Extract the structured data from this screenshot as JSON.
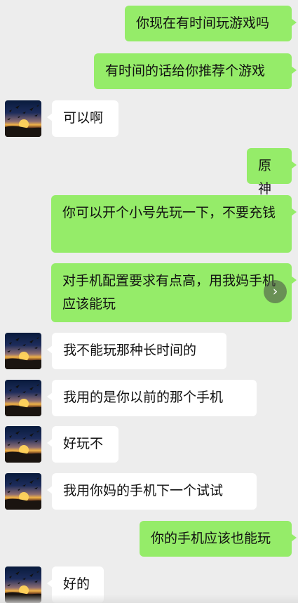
{
  "chat": {
    "messages": [
      {
        "side": "out",
        "text": "你现在有时间玩游戏吗"
      },
      {
        "side": "out",
        "text": "有时间的话给你推荐个游戏"
      },
      {
        "side": "in",
        "text": "可以啊"
      },
      {
        "side": "out",
        "text": "原神"
      },
      {
        "side": "out",
        "text": "你可以开个小号先玩一下，不要充钱"
      },
      {
        "side": "out",
        "text": "对手机配置要求有点高，用我妈手机应该能玩"
      },
      {
        "side": "in",
        "text": "我不能玩那种长时间的"
      },
      {
        "side": "in",
        "text": "我用的是你以前的那个手机"
      },
      {
        "side": "in",
        "text": "好玩不"
      },
      {
        "side": "in",
        "text": "我用你妈的手机下一个试试"
      },
      {
        "side": "out",
        "text": "你的手机应该也能玩"
      },
      {
        "side": "in",
        "text": "好的"
      }
    ]
  },
  "icons": {
    "avatar": "sunset-avatar-icon",
    "next": "chevron-right-icon"
  },
  "colors": {
    "background": "#ededed",
    "outgoing_bubble": "#95ec69",
    "incoming_bubble": "#ffffff"
  }
}
